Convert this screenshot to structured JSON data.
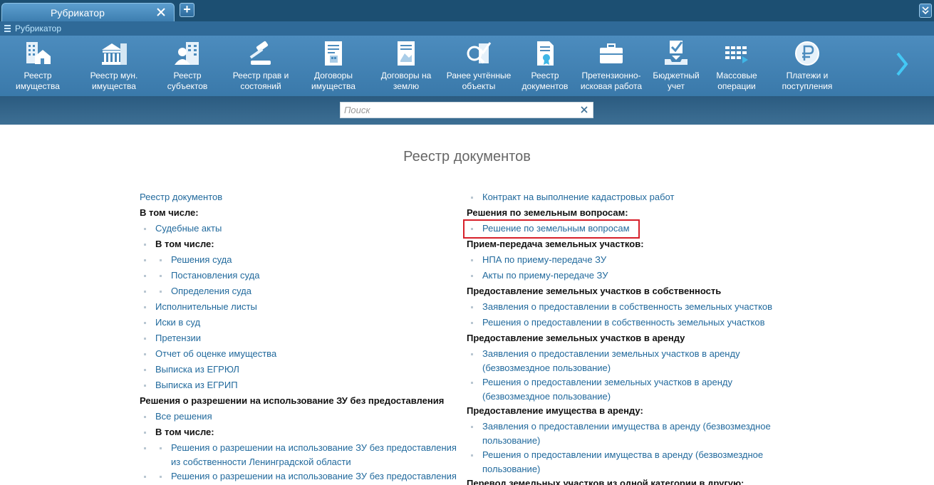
{
  "tabs": {
    "active_label": "Рубрикатор",
    "add_label": "+"
  },
  "breadcrumb": {
    "label": "Рубрикатор"
  },
  "toolbar": {
    "items": [
      {
        "line1": "Реестр имущества",
        "line2": "",
        "icon": "building-house-icon"
      },
      {
        "line1": "Реестр мун.",
        "line2": "имущества",
        "icon": "municipal-building-icon"
      },
      {
        "line1": "Реестр",
        "line2": "субъектов",
        "icon": "person-building-icon"
      },
      {
        "line1": "Реестр прав и",
        "line2": "состояний",
        "icon": "gavel-icon"
      },
      {
        "line1": "Договоры",
        "line2": "имущества",
        "icon": "contract-property-icon"
      },
      {
        "line1": "Договоры на",
        "line2": "землю",
        "icon": "contract-land-icon"
      },
      {
        "line1": "Ранее учтённые",
        "line2": "объекты",
        "icon": "magnifier-check-icon"
      },
      {
        "line1": "Реестр",
        "line2": "документов",
        "icon": "document-certificate-icon"
      },
      {
        "line1": "Претензионно-",
        "line2": "исковая работа",
        "icon": "briefcase-icon"
      },
      {
        "line1": "Бюджетный",
        "line2": "учет",
        "icon": "checkbox-tray-icon"
      },
      {
        "line1": "Массовые",
        "line2": "операции",
        "icon": "grid-operations-icon"
      },
      {
        "line1": "Платежи и",
        "line2": "поступления",
        "icon": "ruble-coin-icon"
      }
    ],
    "next_icon": "chevron-right-icon"
  },
  "search": {
    "placeholder": "Поиск",
    "value": ""
  },
  "page": {
    "title": "Реестр документов"
  },
  "left_column": [
    {
      "text": "Реестр документов",
      "kind": "link",
      "level": 0
    },
    {
      "text": "В том числе:",
      "kind": "head",
      "level": 0
    },
    {
      "text": "Судебные акты",
      "kind": "link",
      "level": 1
    },
    {
      "text": "В том числе:",
      "kind": "head",
      "level": 1
    },
    {
      "text": "Решения суда",
      "kind": "link",
      "level": 2
    },
    {
      "text": "Постановления суда",
      "kind": "link",
      "level": 2
    },
    {
      "text": "Определения суда",
      "kind": "link",
      "level": 2
    },
    {
      "text": "Исполнительные листы",
      "kind": "link",
      "level": 1
    },
    {
      "text": "Иски в суд",
      "kind": "link",
      "level": 1
    },
    {
      "text": "Претензии",
      "kind": "link",
      "level": 1
    },
    {
      "text": "Отчет об оценке имущества",
      "kind": "link",
      "level": 1
    },
    {
      "text": "Выписка из ЕГРЮЛ",
      "kind": "link",
      "level": 1
    },
    {
      "text": "Выписка из ЕГРИП",
      "kind": "link",
      "level": 1
    },
    {
      "text": "Решения о разрешении на использование ЗУ без предоставления",
      "kind": "head",
      "level": 0
    },
    {
      "text": "Все решения",
      "kind": "link",
      "level": 1
    },
    {
      "text": "В том числе:",
      "kind": "head",
      "level": 1
    },
    {
      "text": "Решения о разрешении на использование ЗУ без предоставления из собственности Ленинградской области",
      "kind": "link",
      "level": 2
    },
    {
      "text": "Решения о разрешении на использование ЗУ без предоставления из собственности",
      "kind": "link",
      "level": 2
    }
  ],
  "right_column": [
    {
      "text": "Контракт на выполнение кадастровых работ",
      "kind": "link",
      "level": 1
    },
    {
      "text": "Решения по земельным вопросам:",
      "kind": "head",
      "level": 0
    },
    {
      "text": "Решение по земельным вопросам",
      "kind": "link",
      "level": 1,
      "highlight": true
    },
    {
      "text": "Прием-передача земельных участков:",
      "kind": "head",
      "level": 0
    },
    {
      "text": "НПА по приему-передаче ЗУ",
      "kind": "link",
      "level": 1
    },
    {
      "text": "Акты по приему-передаче ЗУ",
      "kind": "link",
      "level": 1
    },
    {
      "text": "Предоставление земельных участков в собственность",
      "kind": "head",
      "level": 0
    },
    {
      "text": "Заявления о предоставлении в собственность земельных участков",
      "kind": "link",
      "level": 1
    },
    {
      "text": "Решения о предоставлении в собственность земельных участков",
      "kind": "link",
      "level": 1
    },
    {
      "text": "Предоставление земельных участков в аренду",
      "kind": "head",
      "level": 0
    },
    {
      "text": "Заявления о предоставлении земельных участков в аренду (безвозмездное пользование)",
      "kind": "link",
      "level": 1
    },
    {
      "text": "Решения о предоставлении земельных участков в аренду (безвозмездное пользование)",
      "kind": "link",
      "level": 1
    },
    {
      "text": "Предоставление имущества в аренду:",
      "kind": "head",
      "level": 0
    },
    {
      "text": "Заявления о предоставлении имущества в аренду (безвозмездное пользование)",
      "kind": "link",
      "level": 1
    },
    {
      "text": "Решения о предоставлении имущества в аренду (безвозмездное пользование)",
      "kind": "link",
      "level": 1
    },
    {
      "text": "Перевод земельных участков из одной категории в другую:",
      "kind": "head",
      "level": 0
    }
  ],
  "colors": {
    "link": "#226a9d",
    "toolbar": "#4c8cbe",
    "highlight": "#d7202a"
  }
}
